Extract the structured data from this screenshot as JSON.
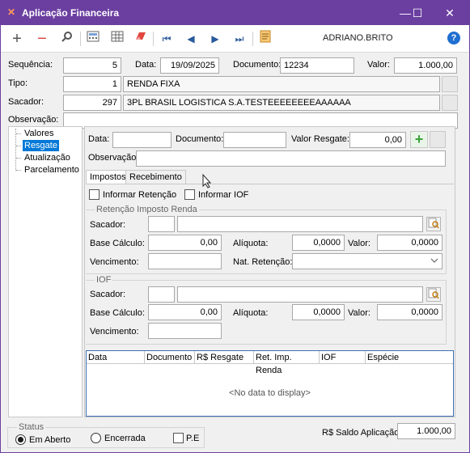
{
  "window": {
    "title": "Aplicação Financeira",
    "minimize": "—",
    "maximize": "☐",
    "close": "✕"
  },
  "toolbar": {
    "user": "ADRIANO.BRITO",
    "help": "?"
  },
  "header": {
    "sequencia_label": "Sequência:",
    "sequencia_value": "5",
    "data_label": "Data:",
    "data_value": "19/09/2025",
    "documento_label": "Documento:",
    "documento_value": "12234",
    "valor_label": "Valor:",
    "valor_value": "1.000,00",
    "tipo_label": "Tipo:",
    "tipo_code": "1",
    "tipo_name": "RENDA FIXA",
    "sacador_label": "Sacador:",
    "sacador_code": "297",
    "sacador_name": "3PL BRASIL LOGISTICA S.A.TESTEEEEEEEEAAAAAA",
    "observacao_label": "Observação:",
    "observacao_value": ""
  },
  "tree": {
    "items": [
      "Valores",
      "Resgate",
      "Atualização",
      "Parcelamento"
    ]
  },
  "resgate": {
    "data_label": "Data:",
    "data_value": "",
    "documento_label": "Documento:",
    "documento_value": "",
    "valor_resgate_label": "Valor Resgate:",
    "valor_resgate_value": "0,00",
    "observacao_label": "Observação:",
    "observacao_value": "",
    "tabs": [
      "Impostos",
      "Recebimento"
    ],
    "informar_retencao": "Informar Retenção",
    "informar_iof": "Informar IOF"
  },
  "retencao": {
    "legend": "Retenção Imposto Renda",
    "sacador_label": "Sacador:",
    "base_calculo_label": "Base Cálculo:",
    "base_calculo_value": "0,00",
    "aliquota_label": "Alíquota:",
    "aliquota_value": "0,0000",
    "valor_label": "Valor:",
    "valor_value": "0,0000",
    "vencimento_label": "Vencimento:",
    "nat_retencao_label": "Nat. Retenção:"
  },
  "iof": {
    "legend": "IOF",
    "sacador_label": "Sacador:",
    "base_calculo_label": "Base Cálculo:",
    "base_calculo_value": "0,00",
    "aliquota_label": "Alíquota:",
    "aliquota_value": "0,0000",
    "valor_label": "Valor:",
    "valor_value": "0,0000",
    "vencimento_label": "Vencimento:"
  },
  "grid": {
    "columns": [
      "Data",
      "Documento",
      "R$ Resgate",
      "Ret. Imp. Renda",
      "IOF",
      "Espécie"
    ],
    "empty_text": "<No data to display>"
  },
  "footer": {
    "status_legend": "Status",
    "em_aberto": "Em Aberto",
    "encerrada": "Encerrada",
    "pe": "P.E",
    "saldo_label": "R$ Saldo Aplicação:",
    "saldo_value": "1.000,00"
  },
  "colors": {
    "titlebar": "#6b3fa0",
    "selection": "#0078d7",
    "add_button": "#3aa33a"
  }
}
